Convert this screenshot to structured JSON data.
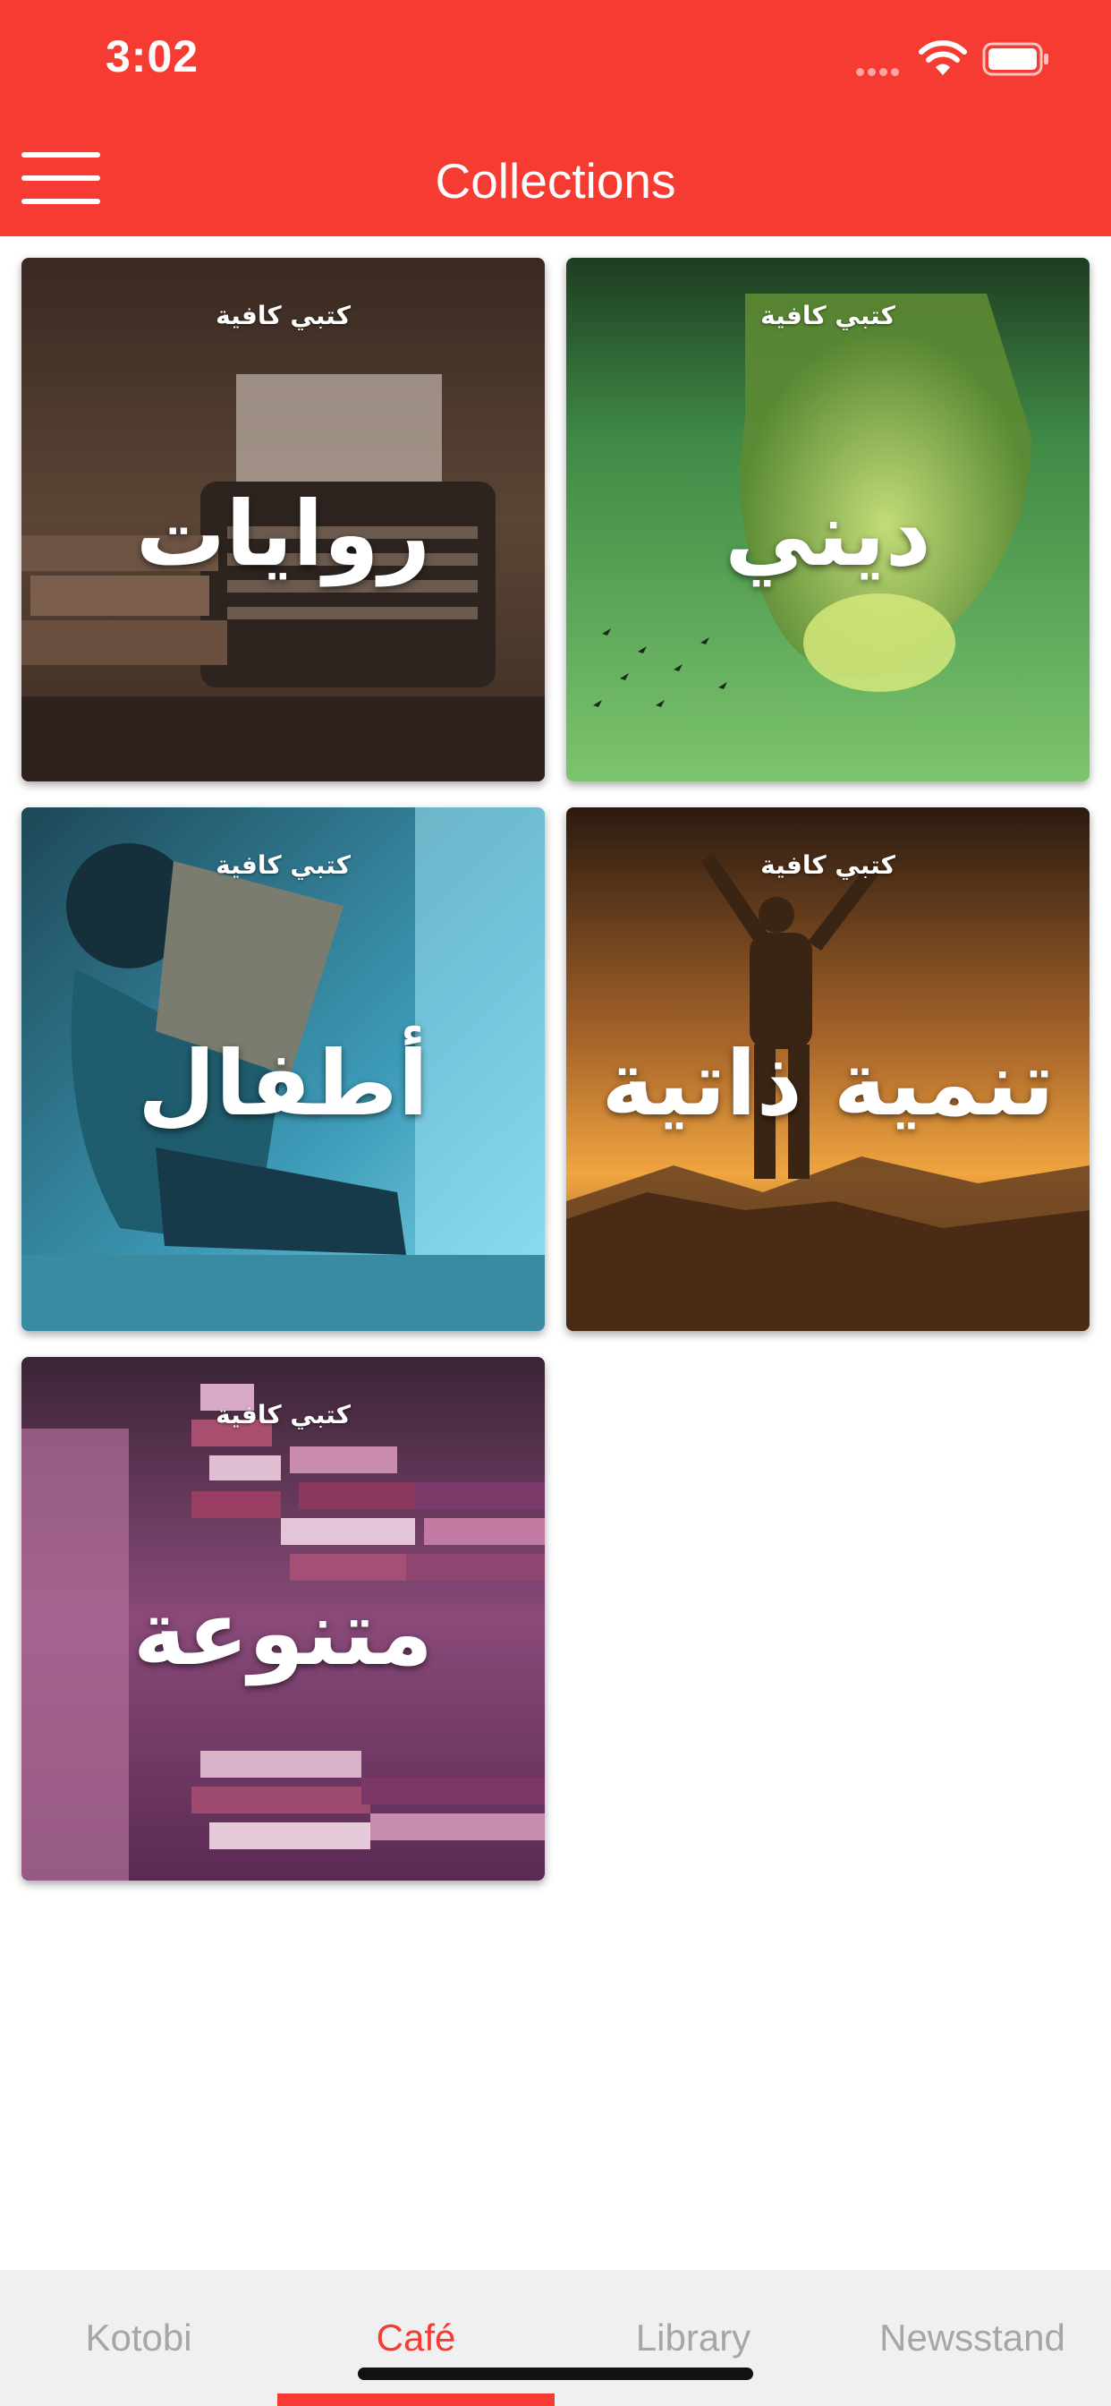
{
  "status_bar": {
    "time": "3:02"
  },
  "header": {
    "title": "Collections",
    "accent_color": "#f63b33"
  },
  "collections": [
    {
      "brand": "كتبي كافية",
      "title": "روايات",
      "theme": "typewriter-and-old-books"
    },
    {
      "brand": "كتبي كافية",
      "title": "ديني",
      "theme": "lantern-and-birds"
    },
    {
      "brand": "كتبي كافية",
      "title": "أطفال",
      "theme": "boy-reading"
    },
    {
      "brand": "كتبي كافية",
      "title": "تنمية ذاتية",
      "theme": "hiker-on-summit"
    },
    {
      "brand": "كتبي كافية",
      "title": "متنوعة",
      "theme": "stacks-of-books"
    }
  ],
  "tabs": [
    {
      "label": "Kotobi"
    },
    {
      "label": "Café"
    },
    {
      "label": "Library"
    },
    {
      "label": "Newsstand"
    }
  ],
  "active_tab": "Café"
}
